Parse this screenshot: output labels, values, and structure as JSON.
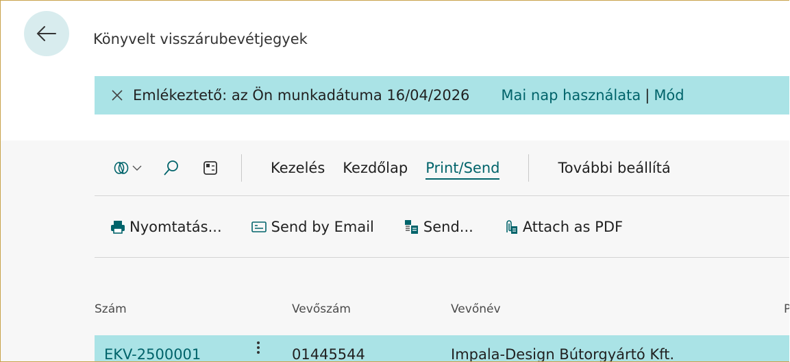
{
  "page": {
    "title": "Könyvelt visszárubevétjegyek"
  },
  "banner": {
    "message": "Emlékeztető: az Ön munkadátuma 16/04/2026",
    "use_today_link": "Mai nap használata",
    "separator": "|",
    "modify_link": "Mód"
  },
  "tabs": [
    {
      "label": "Kezelés"
    },
    {
      "label": "Kezdőlap"
    },
    {
      "label": "Print/Send",
      "active": true
    },
    {
      "label": "További beállítá"
    }
  ],
  "actions": [
    {
      "label": "Nyomtatás...",
      "icon": "printer-icon"
    },
    {
      "label": "Send by Email",
      "icon": "email-icon"
    },
    {
      "label": "Send...",
      "icon": "send-document-icon"
    },
    {
      "label": "Attach as PDF",
      "icon": "attach-pdf-icon"
    }
  ],
  "table": {
    "columns": [
      "Szám",
      "Vevőszám",
      "Vevőnév",
      "P"
    ],
    "rows": [
      {
        "number": "EKV-2500001",
        "customer_no": "01445544",
        "customer_name": "Impala-Design Bútorgyártó Kft."
      }
    ]
  },
  "colors": {
    "accent": "#00636a",
    "banner": "#aae3e6",
    "frame": "#c8a24a"
  }
}
